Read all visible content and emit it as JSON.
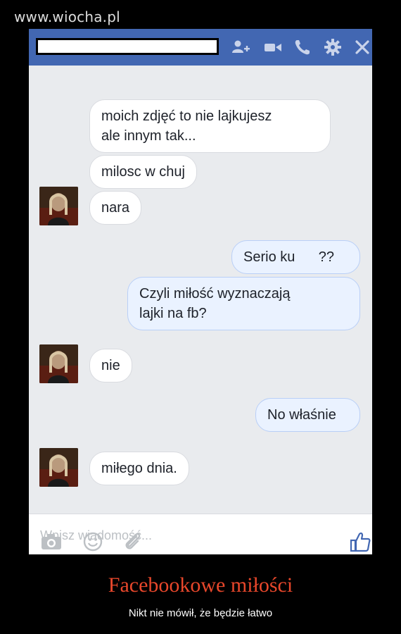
{
  "watermark": "www.wiocha.pl",
  "header": {
    "name_redacted": "",
    "icons": [
      "add-user-icon",
      "video-call-icon",
      "phone-icon",
      "gear-icon",
      "close-icon"
    ],
    "bar_color": "#4267b2"
  },
  "messages": [
    {
      "side": "in",
      "text_lines": [
        "moich zdjęć to nie lajkujesz",
        "ale innym tak..."
      ]
    },
    {
      "side": "in",
      "text_lines": [
        "milosc w chuj"
      ]
    },
    {
      "side": "in",
      "text_lines": [
        "nara"
      ],
      "avatar": true
    },
    {
      "side": "out",
      "text_lines": [
        "Serio ku      ??"
      ]
    },
    {
      "side": "out",
      "text_lines": [
        "Czyli miłość wyznaczają",
        "lajki na fb?"
      ]
    },
    {
      "side": "in",
      "text_lines": [
        "nie"
      ],
      "avatar": true
    },
    {
      "side": "out",
      "text_lines": [
        "No właśnie"
      ]
    },
    {
      "side": "in",
      "text_lines": [
        "miłego dnia."
      ],
      "avatar": true
    }
  ],
  "composer": {
    "placeholder": "Wpisz wiadomość...",
    "icons": [
      "camera-icon",
      "emoji-icon",
      "attach-icon",
      "like-icon"
    ]
  },
  "footer": {
    "title": "Facebookowe miłości",
    "subtitle": "Nikt nie mówił, że będzie łatwo"
  }
}
